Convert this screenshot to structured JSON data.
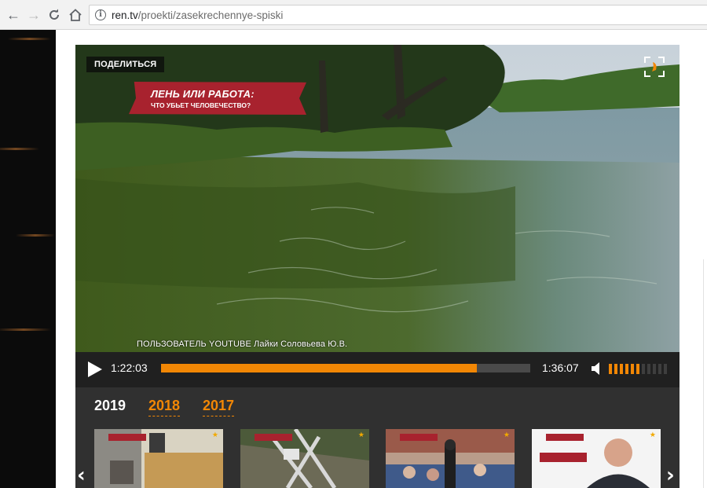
{
  "browser": {
    "url_host": "ren.tv",
    "url_path": "/proekti/zasekrechennye-spiski"
  },
  "player": {
    "share_label": "ПОДЕЛИТЬСЯ",
    "banner_title": "ЛЕНЬ ИЛИ РАБОТА:",
    "banner_subtitle": "ЧТО УБЬЕТ ЧЕЛОВЕЧЕСТВО?",
    "credit": "ПОЛЬЗОВАТЕЛЬ YOUTUBE Лайки Соловьева Ю.В.",
    "time_current": "1:22:03",
    "time_total": "1:36:07",
    "progress": 0.855,
    "volume_level": 6,
    "volume_max": 11
  },
  "years": [
    "2019",
    "2018",
    "2017"
  ],
  "active_year": "2019",
  "colors": {
    "accent": "#f28705",
    "banner": "#a8222e",
    "panel": "#303030"
  }
}
